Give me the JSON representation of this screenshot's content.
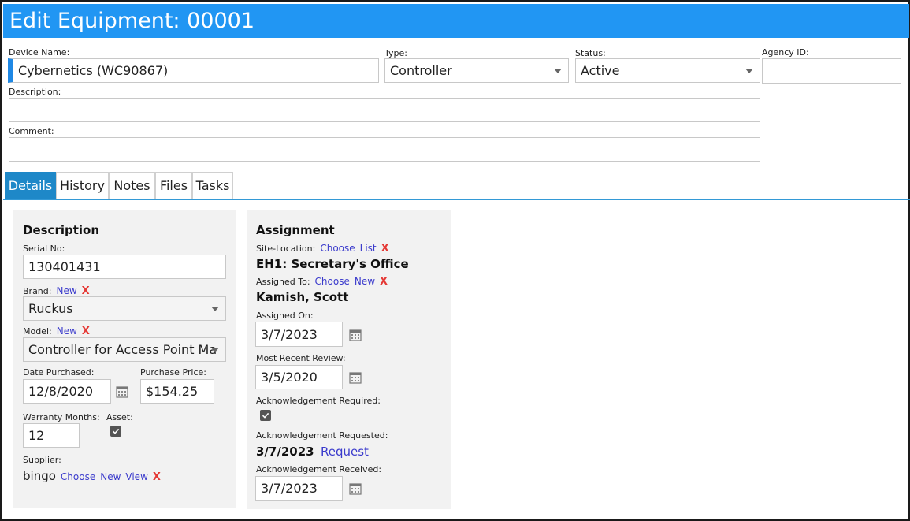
{
  "header": {
    "title": "Edit Equipment: 00001"
  },
  "top_fields": {
    "device_name": {
      "label": "Device Name:",
      "value": "Cybernetics (WC90867)"
    },
    "type": {
      "label": "Type:",
      "value": "Controller"
    },
    "status": {
      "label": "Status:",
      "value": "Active"
    },
    "agency_id": {
      "label": "Agency ID:",
      "value": ""
    },
    "description": {
      "label": "Description:",
      "value": ""
    },
    "comment": {
      "label": "Comment:",
      "value": ""
    }
  },
  "tabs": [
    {
      "label": "Details",
      "active": true
    },
    {
      "label": "History",
      "active": false
    },
    {
      "label": "Notes",
      "active": false
    },
    {
      "label": "Files",
      "active": false
    },
    {
      "label": "Tasks",
      "active": false
    }
  ],
  "description_panel": {
    "title": "Description",
    "serial_label": "Serial No:",
    "serial_value": "130401431",
    "brand_label": "Brand:",
    "brand_new": "New",
    "brand_value": "Ruckus",
    "model_label": "Model:",
    "model_new": "New",
    "model_value": "Controller for Access Point Ma",
    "date_purchased_label": "Date Purchased:",
    "date_purchased_value": "12/8/2020",
    "purchase_price_label": "Purchase Price:",
    "purchase_price_value": "$154.25",
    "warranty_label": "Warranty Months:",
    "warranty_value": "12",
    "asset_label": "Asset:",
    "asset_checked": true,
    "supplier_label": "Supplier:",
    "supplier_value": "bingo",
    "supplier_choose": "Choose",
    "supplier_new": "New",
    "supplier_view": "View",
    "remove_mark": "X"
  },
  "assignment_panel": {
    "title": "Assignment",
    "site_label": "Site-Location:",
    "site_choose": "Choose",
    "site_list": "List",
    "site_value": "EH1: Secretary's Office",
    "assigned_to_label": "Assigned To:",
    "assigned_choose": "Choose",
    "assigned_new": "New",
    "assigned_to_value": "Kamish, Scott",
    "assigned_on_label": "Assigned On:",
    "assigned_on_value": "3/7/2023",
    "recent_review_label": "Most Recent Review:",
    "recent_review_value": "3/5/2020",
    "ack_required_label": "Acknowledgement Required:",
    "ack_required_checked": true,
    "ack_requested_label": "Acknowledgement Requested:",
    "ack_requested_value": "3/7/2023",
    "ack_request_link": "Request",
    "ack_received_label": "Acknowledgement Received:",
    "ack_received_value": "3/7/2023",
    "remove_mark": "X"
  },
  "colors": {
    "header_bg": "#2196f3",
    "tab_active": "#1e88c8",
    "link": "#3b3bcc",
    "remove": "#e53935",
    "panel_bg": "#f2f2f2"
  }
}
